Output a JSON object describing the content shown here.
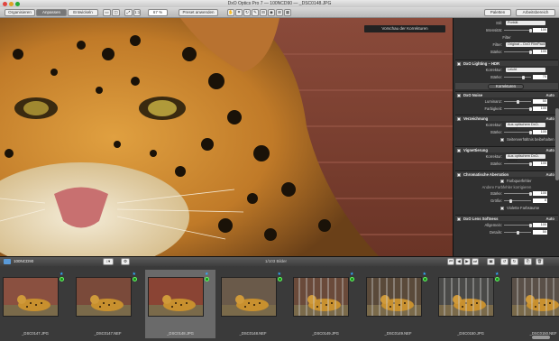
{
  "window": {
    "title": "DxO Optics Pro 7 — 100NCD90 — _DSC0148.JPG"
  },
  "toolbar": {
    "tabs": [
      "Organisieren",
      "Anpassen",
      "Entwickeln"
    ],
    "zoom": "67 %",
    "preset": "Preset anwenden",
    "palettes": "Paletten",
    "workspace": "Arbeitsbereich"
  },
  "viewer": {
    "compare_label": "Vorschau der Korrekturen"
  },
  "panel": {
    "top_rows": [
      {
        "label": "Stil:",
        "value": "Porträt"
      },
      {
        "label": "Intensität:",
        "value": "100"
      }
    ],
    "filter_header": "Filter",
    "filter_rows": [
      {
        "label": "Filter:",
        "value": "Original – DxO FilmPack 1"
      },
      {
        "label": "Stärke:",
        "value": "100"
      }
    ],
    "sections": [
      {
        "title": "DxO Lighting – HDR",
        "rows": [
          {
            "label": "Korrektur:",
            "value": "Leicht"
          },
          {
            "label": "Stärke:",
            "value": "70"
          }
        ]
      },
      {
        "title": "Korrekturen",
        "pinned": true
      },
      {
        "title": "DxO Noise",
        "auto": "Auto",
        "rows": [
          {
            "label": "Luminanz:",
            "value": "50"
          },
          {
            "label": "Farbigkeit:",
            "value": "100"
          }
        ]
      },
      {
        "title": "Verzeichnung",
        "auto": "Auto",
        "rows": [
          {
            "label": "Korrektur:",
            "value": "Aus optischem DxO-Modul"
          },
          {
            "label": "Stärke:",
            "value": "100"
          },
          {
            "label": "Seitenverhältnis beibehalten",
            "check": true
          }
        ]
      },
      {
        "title": "Vignettierung",
        "auto": "Auto",
        "rows": [
          {
            "label": "Korrektur:",
            "value": "Aus optischem DxO-Modul"
          },
          {
            "label": "Stärke:",
            "value": "100"
          }
        ]
      },
      {
        "title": "Chromatische Aberration",
        "auto": "Auto",
        "rows": [
          {
            "label": "Farbquerfehler",
            "check": true
          },
          {
            "label": "Andere Farbfehler korrigieren"
          },
          {
            "label": "Stärke:",
            "value": "100"
          },
          {
            "label": "Größe:",
            "value": "8"
          },
          {
            "label": "Violette Farbsäume",
            "check": true
          }
        ]
      },
      {
        "title": "DxO Lens Softness",
        "auto": "Auto",
        "rows": [
          {
            "label": "Allgemein:",
            "value": "100"
          },
          {
            "label": "Details:",
            "value": "50"
          }
        ]
      }
    ]
  },
  "stripbar": {
    "folder": "100NCD90",
    "count": "1/103 Bilder"
  },
  "filmstrip": [
    {
      "name": "_DSC0147.JPG",
      "selected": false
    },
    {
      "name": "_DSC0147.NEF",
      "selected": false
    },
    {
      "name": "_DSC0148.JPG",
      "selected": true
    },
    {
      "name": "_DSC0148.NEF",
      "selected": false
    },
    {
      "name": "_DSC0149.JPG",
      "selected": false
    },
    {
      "name": "_DSC0149.NEF",
      "selected": false
    },
    {
      "name": "_DSC0150.JPG",
      "selected": false
    },
    {
      "name": "_DSC0150.NEF",
      "selected": false
    }
  ],
  "colors": {
    "accent": "#3399ff",
    "ok": "#1a8a1a",
    "panel_bg": "#303030"
  }
}
